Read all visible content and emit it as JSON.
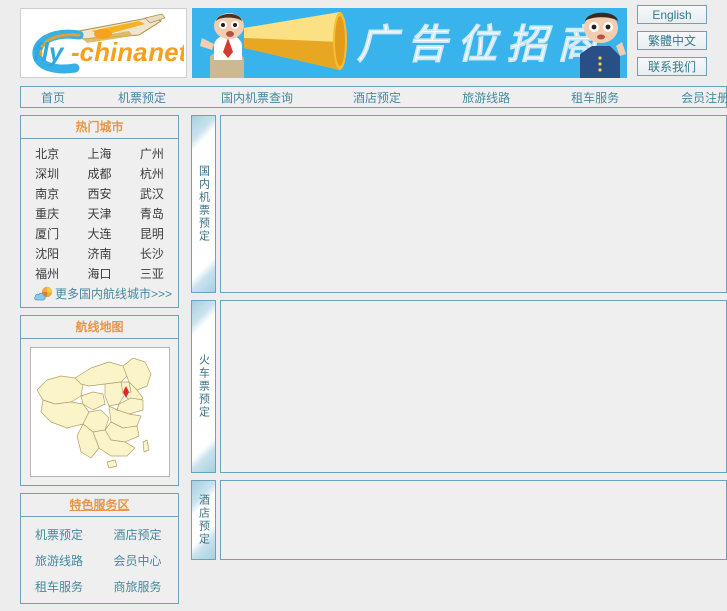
{
  "site": {
    "logo_text": "fly-china.net",
    "logo_accent_color": "#f5a01e",
    "logo_blue_color": "#2fa8dd"
  },
  "banner": {
    "text": "广告位招商",
    "background_color": "#39b3ec",
    "megaphone_color": "#f7c234"
  },
  "side_buttons": [
    {
      "label": "English",
      "name": "english-button"
    },
    {
      "label": "繁體中文",
      "name": "traditional-chinese-button"
    },
    {
      "label": "联系我们",
      "name": "contact-us-button"
    }
  ],
  "nav": {
    "items": [
      "首页",
      "机票预定",
      "国内机票查询",
      "酒店预定",
      "旅游线路",
      "租车服务",
      "会员注册区"
    ]
  },
  "sidebar": {
    "cities_panel": {
      "title": "热门城市",
      "cities": [
        "北京",
        "上海",
        "广州",
        "深圳",
        "成都",
        "杭州",
        "南京",
        "西安",
        "武汉",
        "重庆",
        "天津",
        "青岛",
        "厦门",
        "大连",
        "昆明",
        "沈阳",
        "济南",
        "长沙",
        "福州",
        "海口",
        "三亚"
      ],
      "more_label": "更多国内航线城市",
      "more_suffix": ">>>",
      "more_icon": "cloud-globe-icon"
    },
    "map_panel": {
      "title": "航线地图",
      "map_name": "china-map",
      "marker_city": "北京",
      "land_color": "#faf4c8",
      "marker_color": "#e8262a"
    },
    "services_panel": {
      "title": "特色服务区",
      "links": [
        "机票预定",
        "酒店预定",
        "旅游线路",
        "会员中心",
        "租车服务",
        "商旅服务"
      ]
    }
  },
  "main": {
    "modules": [
      {
        "tab_label": "国内机票预定",
        "name": "domestic-flight-booking"
      },
      {
        "tab_label": "火车票预定",
        "name": "train-ticket-booking"
      },
      {
        "tab_label": "酒店预定",
        "name": "hotel-booking"
      }
    ]
  },
  "colors": {
    "border": "#6aa4bb",
    "panel_bg": "#efefef",
    "page_bg": "#ededed",
    "link": "#46899f",
    "heading": "#e8964a"
  }
}
